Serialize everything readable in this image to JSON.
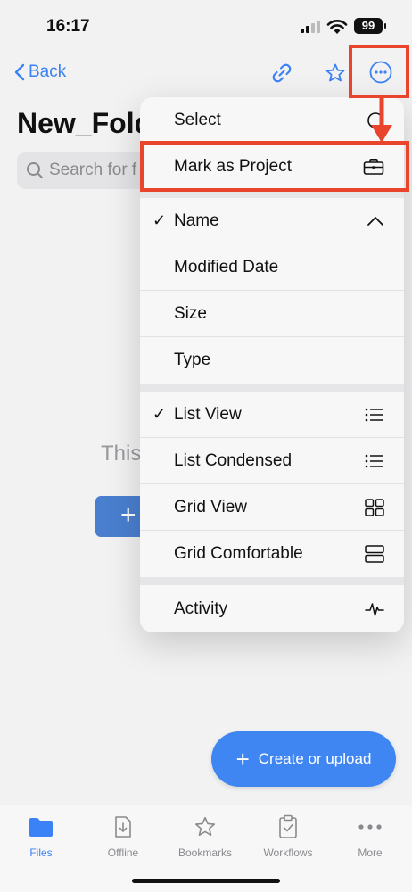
{
  "status": {
    "time": "16:17",
    "battery": "99"
  },
  "nav": {
    "back_label": "Back",
    "link_icon": "link-icon",
    "star_icon": "star-icon",
    "more_icon": "more-icon"
  },
  "page": {
    "title": "New_Folder",
    "search_placeholder": "Search for f",
    "empty_text": "This"
  },
  "menu": {
    "group1": [
      {
        "label": "Select",
        "icon": "select-icon"
      },
      {
        "label": "Mark as Project",
        "icon": "briefcase-icon"
      }
    ],
    "group2": [
      {
        "label": "Name",
        "checked": true,
        "icon": "chevron-up-icon"
      },
      {
        "label": "Modified Date",
        "checked": false
      },
      {
        "label": "Size",
        "checked": false
      },
      {
        "label": "Type",
        "checked": false
      }
    ],
    "group3": [
      {
        "label": "List View",
        "checked": true,
        "icon": "list-icon"
      },
      {
        "label": "List Condensed",
        "checked": false,
        "icon": "list-condensed-icon"
      },
      {
        "label": "Grid View",
        "checked": false,
        "icon": "grid-icon"
      },
      {
        "label": "Grid Comfortable",
        "checked": false,
        "icon": "grid-comfortable-icon"
      }
    ],
    "group4": [
      {
        "label": "Activity",
        "icon": "activity-icon"
      }
    ],
    "check_glyph": "✓"
  },
  "fab": {
    "label": "Create or upload"
  },
  "tabs": [
    {
      "label": "Files",
      "icon": "folder-icon",
      "active": true
    },
    {
      "label": "Offline",
      "icon": "offline-icon",
      "active": false
    },
    {
      "label": "Bookmarks",
      "icon": "star-icon",
      "active": false
    },
    {
      "label": "Workflows",
      "icon": "clipboard-check-icon",
      "active": false
    },
    {
      "label": "More",
      "icon": "more-dots-icon",
      "active": false
    }
  ],
  "colors": {
    "accent": "#3b82f6",
    "annotation": "#e8452c",
    "fab": "#3f86f2"
  }
}
